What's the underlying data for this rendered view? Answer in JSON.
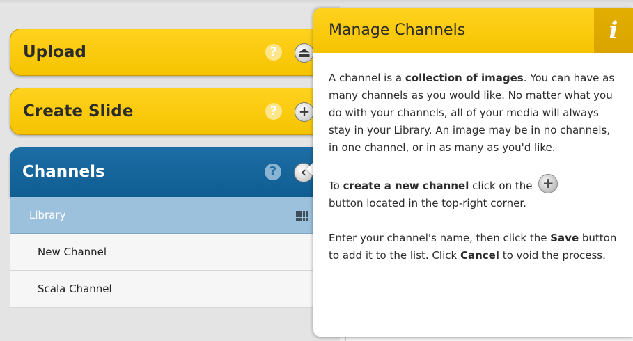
{
  "sidebar": {
    "upload": {
      "label": "Upload",
      "help": "?",
      "icon": "upload-icon"
    },
    "create_slide": {
      "label": "Create Slide",
      "help": "?",
      "icon": "plus-icon"
    },
    "channels": {
      "label": "Channels",
      "help": "?",
      "icon": "chevron-left-icon"
    },
    "channel_list": [
      {
        "label": "Library",
        "selected": true,
        "icon": "grid-icon"
      },
      {
        "label": "New Channel"
      },
      {
        "label": "Scala Channel"
      }
    ]
  },
  "popup": {
    "title": "Manage Channels",
    "info_icon": "i",
    "p1": {
      "a": "A channel is a ",
      "b": "collection of images",
      "c": ". You can have as many channels as you would like. No matter what you do with your channels, all of your media will always stay in your Library. An image may be in no channels, in one channel, or in as many as you'd like."
    },
    "p2": {
      "a": "To ",
      "b": "create a new channel",
      "c": " click on the ",
      "d": "button located in the top-right corner."
    },
    "p3": {
      "a": "Enter your channel's name, then click the ",
      "b": "Save",
      "c": " button to add it to the list. Click ",
      "d": "Cancel",
      "e": " to void the process."
    }
  },
  "colors": {
    "yellow": "#f5c300",
    "blue": "#0f5d92",
    "library_selected": "#9cc1dd"
  }
}
